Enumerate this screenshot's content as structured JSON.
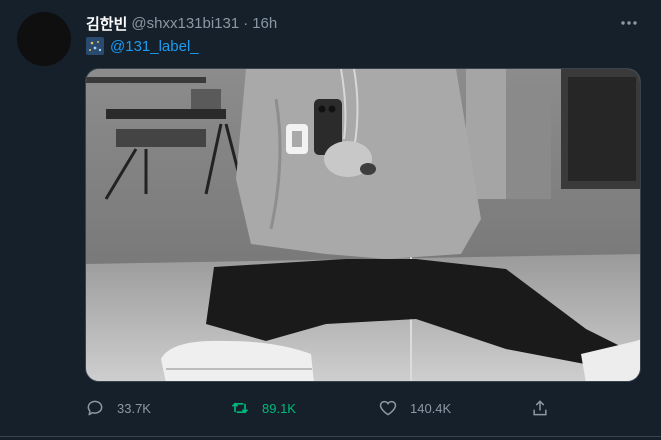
{
  "tweet": {
    "author_name": "김한빈",
    "author_handle": "@shxx131bi131",
    "separator": "·",
    "time": "16h",
    "mention": "@131_label_",
    "media_alt": "Black and white photo of a person in a hoodie sitting on a studio floor taking a mirror selfie"
  },
  "actions": {
    "reply_count": "33.7K",
    "retweet_count": "89.1K",
    "like_count": "140.4K"
  },
  "colors": {
    "background": "#15202b",
    "accent": "#1d9bf0",
    "retweet_active": "#00ba7c",
    "muted": "#8b98a5"
  },
  "icons": {
    "more": "more-horizontal-icon",
    "reply": "reply-icon",
    "retweet": "retweet-icon",
    "like": "heart-icon",
    "share": "share-icon",
    "emoji": "globe-emoji-icon"
  }
}
